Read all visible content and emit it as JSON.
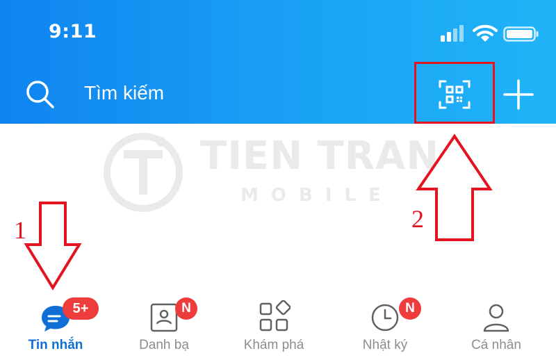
{
  "status_bar": {
    "time": "9:11"
  },
  "header": {
    "search_placeholder": "Tìm kiếm",
    "qr_icon": "qr-scan-icon",
    "plus_icon": "plus-icon"
  },
  "watermark": {
    "title": "TIEN TRAN",
    "subtitle": "MOBILE"
  },
  "annotations": {
    "step_1": "1",
    "step_2": "2"
  },
  "tabs": [
    {
      "label": "Tin nhắn",
      "icon": "chat-icon",
      "badge": "5+",
      "active": true
    },
    {
      "label": "Danh bạ",
      "icon": "contacts-icon",
      "badge": "N",
      "active": false
    },
    {
      "label": "Khám phá",
      "icon": "apps-icon",
      "badge": "",
      "active": false
    },
    {
      "label": "Nhật ký",
      "icon": "clock-icon",
      "badge": "N",
      "active": false
    },
    {
      "label": "Cá nhân",
      "icon": "person-icon",
      "badge": "",
      "active": false
    }
  ],
  "colors": {
    "header_blue": "#0f84f0",
    "active_blue": "#0f6fd6",
    "badge_red": "#ee3b3b",
    "annotation_red": "#e3141f"
  }
}
